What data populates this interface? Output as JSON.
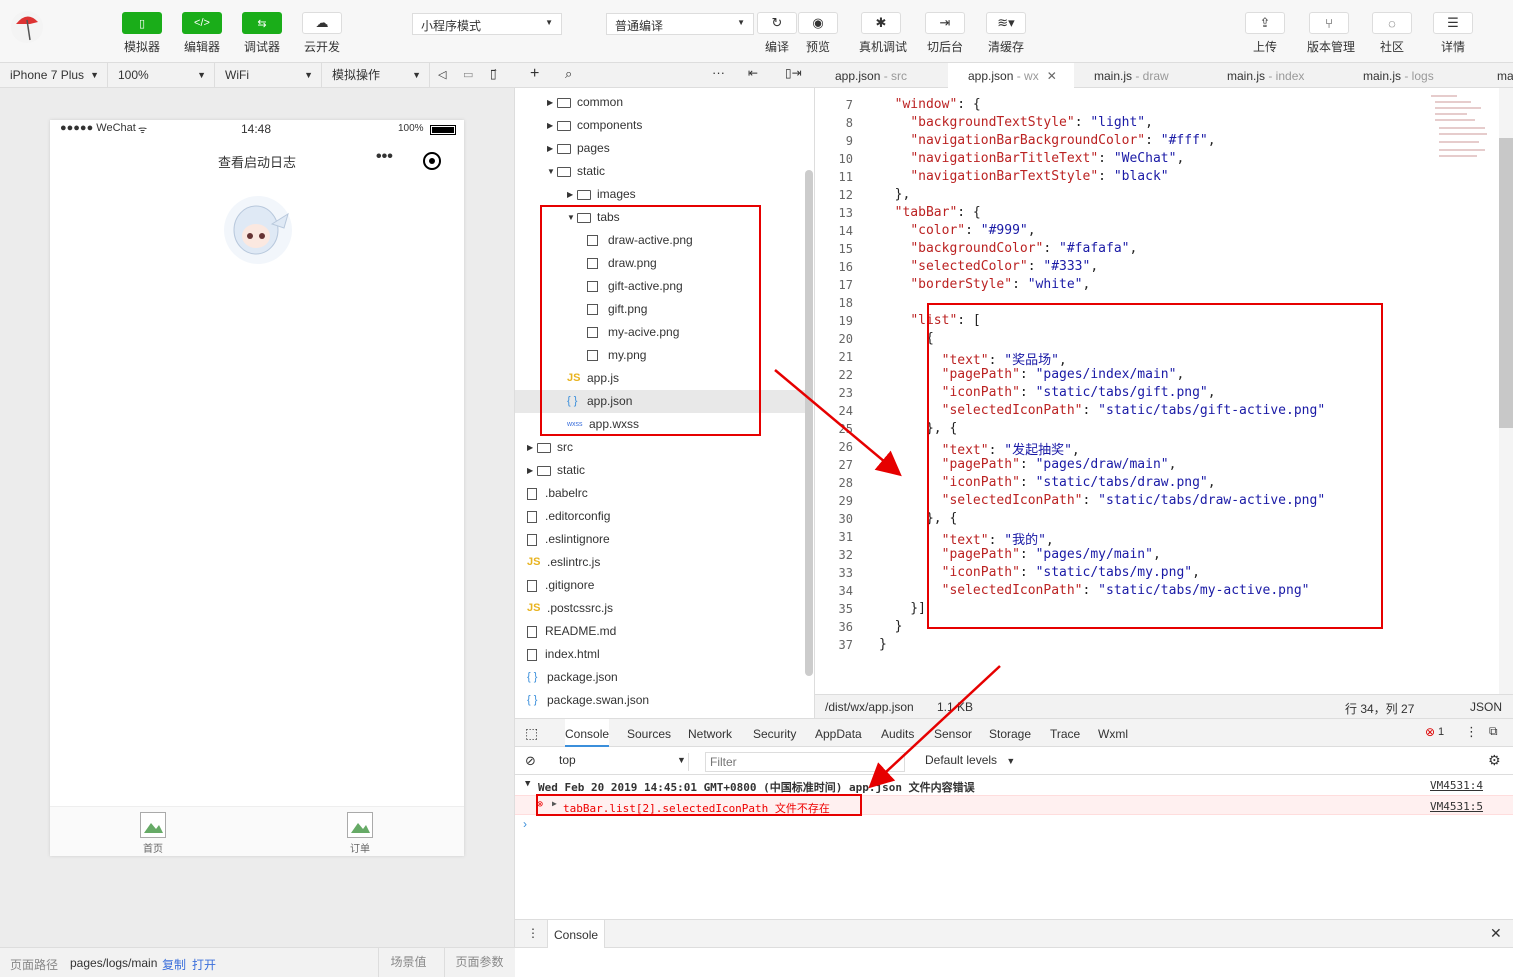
{
  "toolbar": {
    "simulator": "模拟器",
    "editor": "编辑器",
    "debugger": "调试器",
    "cloud": "云开发",
    "mode": "小程序模式",
    "compile_mode": "普通编译",
    "compile": "编译",
    "preview": "预览",
    "real_debug": "真机调试",
    "background": "切后台",
    "clear_cache": "清缓存",
    "upload": "上传",
    "version": "版本管理",
    "community": "社区",
    "details": "详情"
  },
  "simbar": {
    "device": "iPhone 7 Plus",
    "zoom": "100%",
    "network": "WiFi",
    "ops": "模拟操作"
  },
  "phone": {
    "carrier": "●●●●● WeChat",
    "time": "14:48",
    "battery": "100%",
    "title": "查看启动日志",
    "tab1": "首页",
    "tab2": "订单"
  },
  "tree": [
    {
      "indent": 1,
      "type": "folder",
      "arrow": "▶",
      "name": "common"
    },
    {
      "indent": 1,
      "type": "folder",
      "arrow": "▶",
      "name": "components"
    },
    {
      "indent": 1,
      "type": "folder",
      "arrow": "▶",
      "name": "pages"
    },
    {
      "indent": 1,
      "type": "folder",
      "arrow": "▼",
      "name": "static"
    },
    {
      "indent": 2,
      "type": "folder",
      "arrow": "▶",
      "name": "images"
    },
    {
      "indent": 2,
      "type": "folder",
      "arrow": "▼",
      "name": "tabs"
    },
    {
      "indent": 3,
      "type": "img",
      "name": "draw-active.png"
    },
    {
      "indent": 3,
      "type": "img",
      "name": "draw.png"
    },
    {
      "indent": 3,
      "type": "img",
      "name": "gift-active.png"
    },
    {
      "indent": 3,
      "type": "img",
      "name": "gift.png"
    },
    {
      "indent": 3,
      "type": "img",
      "name": "my-acive.png"
    },
    {
      "indent": 3,
      "type": "img",
      "name": "my.png"
    },
    {
      "indent": 2,
      "type": "js",
      "name": "app.js"
    },
    {
      "indent": 2,
      "type": "json",
      "name": "app.json",
      "selected": true
    },
    {
      "indent": 2,
      "type": "wxss",
      "name": "app.wxss"
    },
    {
      "indent": 0,
      "type": "folder",
      "arrow": "▶",
      "name": "src"
    },
    {
      "indent": 0,
      "type": "folder",
      "arrow": "▶",
      "name": "static"
    },
    {
      "indent": 0,
      "type": "file",
      "name": ".babelrc"
    },
    {
      "indent": 0,
      "type": "file",
      "name": ".editorconfig"
    },
    {
      "indent": 0,
      "type": "file",
      "name": ".eslintignore"
    },
    {
      "indent": 0,
      "type": "js",
      "name": ".eslintrc.js"
    },
    {
      "indent": 0,
      "type": "file",
      "name": ".gitignore"
    },
    {
      "indent": 0,
      "type": "js",
      "name": ".postcssrc.js"
    },
    {
      "indent": 0,
      "type": "file",
      "name": "README.md"
    },
    {
      "indent": 0,
      "type": "file",
      "name": "index.html"
    },
    {
      "indent": 0,
      "type": "json",
      "name": "package.json"
    },
    {
      "indent": 0,
      "type": "json",
      "name": "package.swan.json"
    }
  ],
  "editor_tabs": [
    {
      "name": "app.json",
      "sub": " - src"
    },
    {
      "name": "app.json",
      "sub": " - wx",
      "active": true
    },
    {
      "name": "main.js",
      "sub": " - draw"
    },
    {
      "name": "main.js",
      "sub": " - index"
    },
    {
      "name": "main.js",
      "sub": " - logs"
    },
    {
      "name": "mai",
      "sub": ""
    }
  ],
  "code": [
    {
      "n": "7",
      "t": "  \"window\": {"
    },
    {
      "n": "8",
      "t": "    \"backgroundTextStyle\": \"light\","
    },
    {
      "n": "9",
      "t": "    \"navigationBarBackgroundColor\": \"#fff\","
    },
    {
      "n": "10",
      "t": "    \"navigationBarTitleText\": \"WeChat\","
    },
    {
      "n": "11",
      "t": "    \"navigationBarTextStyle\": \"black\""
    },
    {
      "n": "12",
      "t": "  },"
    },
    {
      "n": "13",
      "t": "  \"tabBar\": {"
    },
    {
      "n": "14",
      "t": "    \"color\": \"#999\","
    },
    {
      "n": "15",
      "t": "    \"backgroundColor\": \"#fafafa\","
    },
    {
      "n": "16",
      "t": "    \"selectedColor\": \"#333\","
    },
    {
      "n": "17",
      "t": "    \"borderStyle\": \"white\","
    },
    {
      "n": "18",
      "t": ""
    },
    {
      "n": "19",
      "t": "    \"list\": ["
    },
    {
      "n": "20",
      "t": "      {"
    },
    {
      "n": "21",
      "t": "        \"text\": \"奖品场\","
    },
    {
      "n": "22",
      "t": "        \"pagePath\": \"pages/index/main\","
    },
    {
      "n": "23",
      "t": "        \"iconPath\": \"static/tabs/gift.png\","
    },
    {
      "n": "24",
      "t": "        \"selectedIconPath\": \"static/tabs/gift-active.png\""
    },
    {
      "n": "25",
      "t": "      }, {"
    },
    {
      "n": "26",
      "t": "        \"text\": \"发起抽奖\","
    },
    {
      "n": "27",
      "t": "        \"pagePath\": \"pages/draw/main\","
    },
    {
      "n": "28",
      "t": "        \"iconPath\": \"static/tabs/draw.png\","
    },
    {
      "n": "29",
      "t": "        \"selectedIconPath\": \"static/tabs/draw-active.png\""
    },
    {
      "n": "30",
      "t": "      }, {"
    },
    {
      "n": "31",
      "t": "        \"text\": \"我的\","
    },
    {
      "n": "32",
      "t": "        \"pagePath\": \"pages/my/main\","
    },
    {
      "n": "33",
      "t": "        \"iconPath\": \"static/tabs/my.png\","
    },
    {
      "n": "34",
      "t": "        \"selectedIconPath\": \"static/tabs/my-active.png\""
    },
    {
      "n": "35",
      "t": "    }]"
    },
    {
      "n": "36",
      "t": "  }"
    },
    {
      "n": "37",
      "t": "}"
    }
  ],
  "editor_status": {
    "path": "/dist/wx/app.json",
    "size": "1.1 KB",
    "position": "行 34，列 27",
    "lang": "JSON"
  },
  "devtools": {
    "tabs": [
      "Console",
      "Sources",
      "Network",
      "Security",
      "AppData",
      "Audits",
      "Sensor",
      "Storage",
      "Trace",
      "Wxml"
    ],
    "error_count": "1",
    "context": "top",
    "filter_placeholder": "Filter",
    "levels": "Default levels",
    "log1": "Wed Feb 20 2019 14:45:01 GMT+0800 (中国标准时间) app.json 文件内容错误",
    "log1_src": "VM4531:4",
    "log2": "tabBar.list[2].selectedIconPath 文件不存在",
    "log2_src": "VM4531:5",
    "drawer_tab": "Console"
  },
  "status": {
    "path_label": "页面路径",
    "path": "pages/logs/main",
    "copy": "复制",
    "open": "打开",
    "scene": "场景值",
    "params": "页面参数"
  }
}
